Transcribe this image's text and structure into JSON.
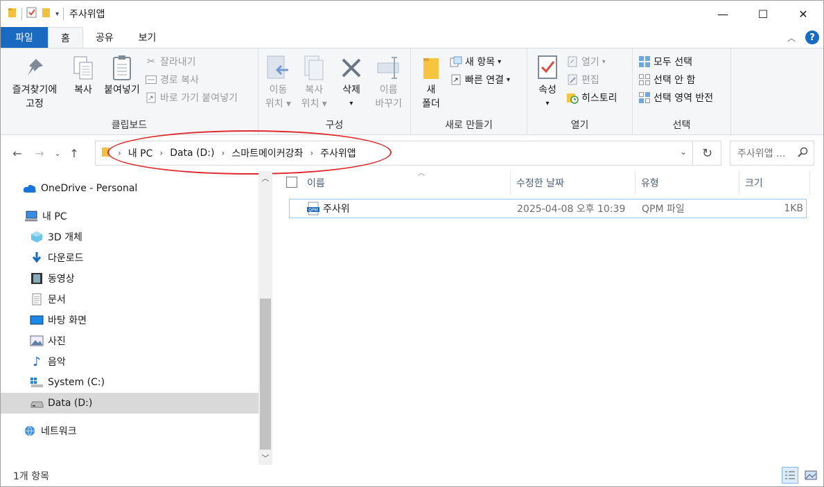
{
  "window": {
    "title": "주사위앱",
    "controls": {
      "minimize": "—",
      "maximize": "☐",
      "close": "✕"
    }
  },
  "tabs": [
    {
      "label": "파일"
    },
    {
      "label": "홈"
    },
    {
      "label": "공유"
    },
    {
      "label": "보기"
    }
  ],
  "ribbon": {
    "clipboard": {
      "label": "클립보드",
      "pin_line1": "즐겨찾기에",
      "pin_line2": "고정",
      "copy": "복사",
      "paste": "붙여넣기",
      "cut": "잘라내기",
      "copy_path": "경로 복사",
      "paste_shortcut": "바로 가기 붙여넣기"
    },
    "organize": {
      "label": "구성",
      "move_line1": "이동",
      "move_line2": "위치",
      "copy_line1": "복사",
      "copy_line2": "위치",
      "delete": "삭제",
      "rename_line1": "이름",
      "rename_line2": "바꾸기"
    },
    "new": {
      "label": "새로 만들기",
      "folder_line1": "새",
      "folder_line2": "폴더",
      "new_item": "새 항목",
      "easy_access": "빠른 연결"
    },
    "open": {
      "label": "열기",
      "properties": "속성",
      "open": "열기",
      "edit": "편집",
      "history": "히스토리"
    },
    "select": {
      "label": "선택",
      "select_all": "모두 선택",
      "select_none": "선택 안 함",
      "invert": "선택 영역 반전"
    }
  },
  "address": {
    "crumbs": [
      "내 PC",
      "Data (D:)",
      "스마트메이커강좌",
      "주사위앱"
    ],
    "search_placeholder": "주사위앱 ..."
  },
  "nav": {
    "items": [
      {
        "label": "OneDrive - Personal",
        "icon": "cloud-icon"
      },
      {
        "label": "내 PC",
        "icon": "computer-icon"
      },
      {
        "label": "3D 개체",
        "icon": "cube-icon"
      },
      {
        "label": "다운로드",
        "icon": "download-icon"
      },
      {
        "label": "동영상",
        "icon": "video-icon"
      },
      {
        "label": "문서",
        "icon": "document-icon"
      },
      {
        "label": "바탕 화면",
        "icon": "desktop-icon"
      },
      {
        "label": "사진",
        "icon": "picture-icon"
      },
      {
        "label": "음악",
        "icon": "music-icon"
      },
      {
        "label": "System (C:)",
        "icon": "drive-icon"
      },
      {
        "label": "Data (D:)",
        "icon": "drive-icon"
      },
      {
        "label": "네트워크",
        "icon": "network-icon"
      }
    ]
  },
  "filelist": {
    "columns": {
      "name": "이름",
      "modified": "수정한 날짜",
      "type": "유형",
      "size": "크기"
    },
    "rows": [
      {
        "name": "주사위",
        "modified": "2025-04-08 오후 10:39",
        "type": "QPM 파일",
        "size": "1KB",
        "icon_text": "QPM"
      }
    ]
  },
  "status": {
    "count": "1개 항목"
  },
  "colors": {
    "accent": "#1a6ac2",
    "highlight": "#e0282e",
    "selection": "#d9d9d9"
  }
}
